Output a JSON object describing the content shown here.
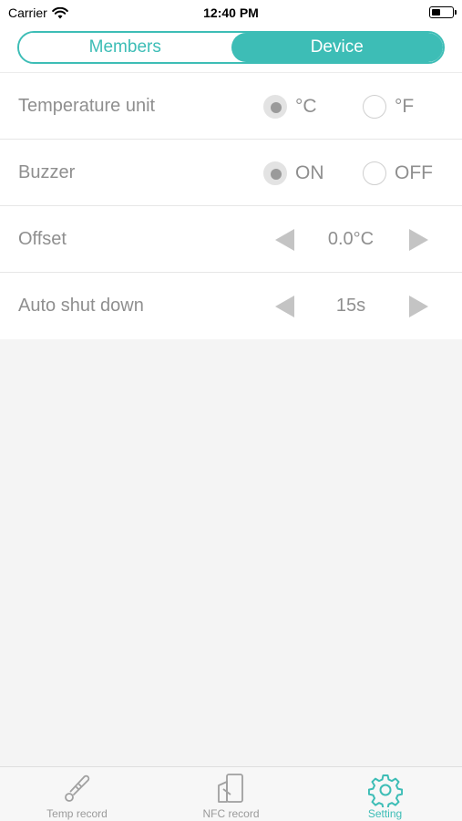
{
  "status_bar": {
    "carrier": "Carrier",
    "time": "12:40 PM"
  },
  "segment": {
    "tabs": [
      {
        "label": "Members",
        "active": false
      },
      {
        "label": "Device",
        "active": true
      }
    ]
  },
  "settings": {
    "temperature_unit": {
      "label": "Temperature unit",
      "options": [
        "°C",
        "°F"
      ],
      "selected": "°C"
    },
    "buzzer": {
      "label": "Buzzer",
      "options": [
        "ON",
        "OFF"
      ],
      "selected": "ON"
    },
    "offset": {
      "label": "Offset",
      "value": "0.0°C"
    },
    "auto_shut_down": {
      "label": "Auto shut down",
      "value": "15s"
    }
  },
  "tab_bar": {
    "items": [
      {
        "label": "Temp record",
        "icon": "thermometer-icon",
        "active": false
      },
      {
        "label": "NFC record",
        "icon": "nfc-card-icon",
        "active": false
      },
      {
        "label": "Setting",
        "icon": "gear-icon",
        "active": true
      }
    ]
  },
  "colors": {
    "accent": "#3dbdb6",
    "text_muted": "#8f8f8f",
    "background": "#f4f4f4"
  }
}
